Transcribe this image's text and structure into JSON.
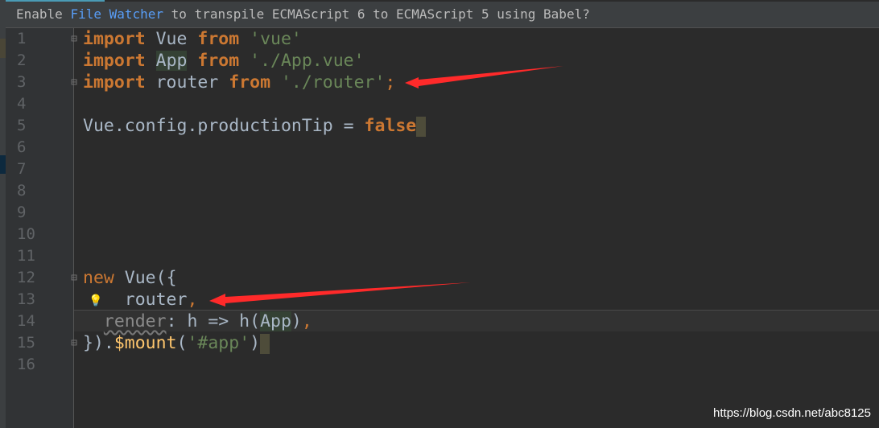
{
  "banner": {
    "pre": "Enable ",
    "link": "File Watcher",
    "post": " to transpile ECMAScript 6 to ECMAScript 5 using Babel?"
  },
  "line_numbers": [
    "1",
    "2",
    "3",
    "4",
    "5",
    "6",
    "7",
    "8",
    "9",
    "10",
    "11",
    "12",
    "13",
    "14",
    "15",
    "16"
  ],
  "code": {
    "l1": {
      "k1": "import",
      "t1": " Vue ",
      "k2": "from",
      "s1": " 'vue'"
    },
    "l2": {
      "k1": "import",
      "t0": " ",
      "h1": "App",
      "t1": " ",
      "k2": "from",
      "s1": " './App.vue'"
    },
    "l3": {
      "k1": "import",
      "t1": " router ",
      "k2": "from",
      "s1": " './router'",
      "p": ";"
    },
    "l5": {
      "t1": "Vue.config.productionTip = ",
      "k1": "false"
    },
    "l12": {
      "k1": "new",
      "t1": " Vue({"
    },
    "l13": {
      "t1": "    router",
      "p": ","
    },
    "l14": {
      "t0": "  ",
      "d1": "render",
      "t1": ": h => h(",
      "h1": "App",
      "t2": ")",
      "p": ","
    },
    "l15": {
      "t1": "}).",
      "f1": "$mount",
      "t2": "(",
      "s1": "'#app'",
      "t3": ")"
    }
  },
  "watermark": "https://blog.csdn.net/abc8125",
  "colors": {
    "keyword": "#cc7832",
    "string": "#6a8759",
    "text": "#a9b7c6",
    "arrow": "#ff2a2a"
  }
}
